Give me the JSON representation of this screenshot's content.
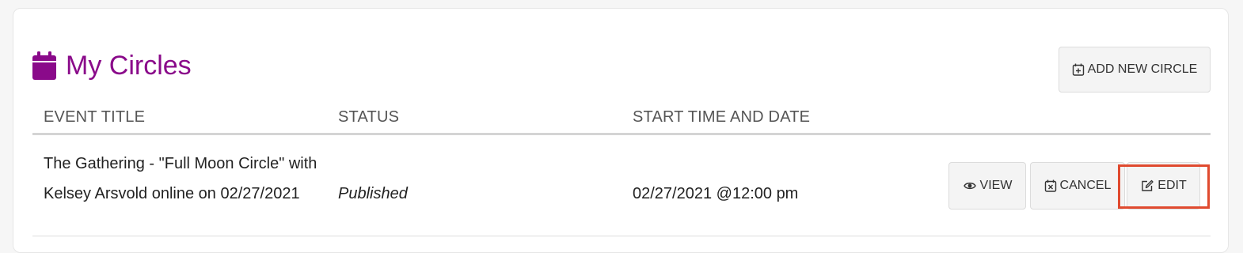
{
  "section": {
    "title": "My Circles",
    "add_button_label": "ADD NEW CIRCLE"
  },
  "table": {
    "columns": [
      "EVENT TITLE",
      "STATUS",
      "START TIME AND DATE"
    ],
    "rows": [
      {
        "title": "The Gathering - \"Full Moon Circle\" with Kelsey Arsvold online on 02/27/2021",
        "status": "Published",
        "start": "02/27/2021 @12:00 pm",
        "actions": {
          "view": "VIEW",
          "cancel": "CANCEL",
          "edit": "EDIT"
        }
      }
    ]
  },
  "colors": {
    "brand": "#8a0a8a",
    "highlight": "#e04a2f"
  },
  "icons": {
    "heading": "calendar-icon",
    "add": "calendar-plus-icon",
    "view": "eye-icon",
    "cancel": "calendar-x-icon",
    "edit": "edit-icon"
  }
}
